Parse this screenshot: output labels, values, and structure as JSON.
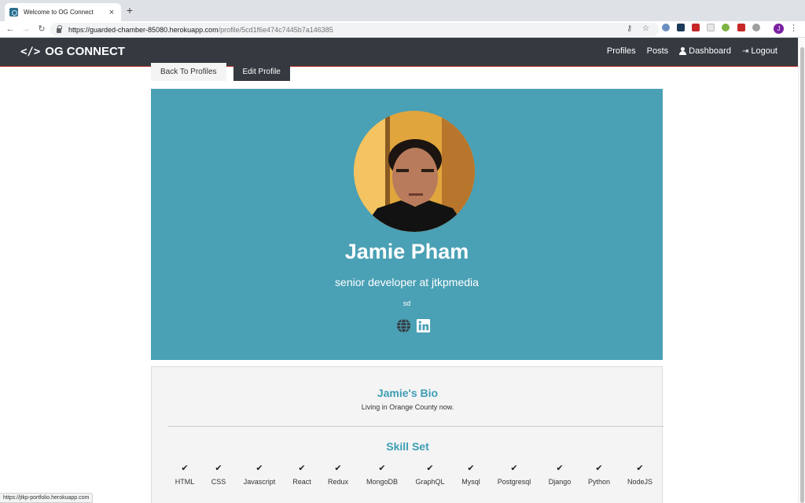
{
  "browser": {
    "tab_title": "Welcome to OG Connect",
    "tab_close": "×",
    "new_tab": "+",
    "url_host": "https://guarded-chamber-85080.herokuapp.com",
    "url_path": "/profile/5cd1f6e474c7445b7a146385",
    "profile_initial": "J",
    "status_url": "https://jtkp-portfolio.herokuapp.com"
  },
  "site_nav": {
    "brand": "OG CONNECT",
    "brand_icon": "</>",
    "links": {
      "profiles": "Profiles",
      "posts": "Posts",
      "dashboard": "Dashboard",
      "logout": "Logout"
    }
  },
  "actions": {
    "back": "Back To Profiles",
    "edit": "Edit Profile"
  },
  "profile": {
    "name": "Jamie Pham",
    "status": "senior developer at jtkpmedia",
    "location": "sd",
    "social_icons": [
      "globe-icon",
      "linkedin-icon"
    ],
    "accent_color": "#4aa0b5"
  },
  "about": {
    "bio_title": "Jamie's Bio",
    "bio_text": "Living in Orange County now.",
    "skills_title": "Skill Set",
    "skills": [
      "HTML",
      "CSS",
      "Javascript",
      "React",
      "Redux",
      "MongoDB",
      "GraphQL",
      "Mysql",
      "Postgresql",
      "Django",
      "Python",
      "NodeJS"
    ]
  }
}
